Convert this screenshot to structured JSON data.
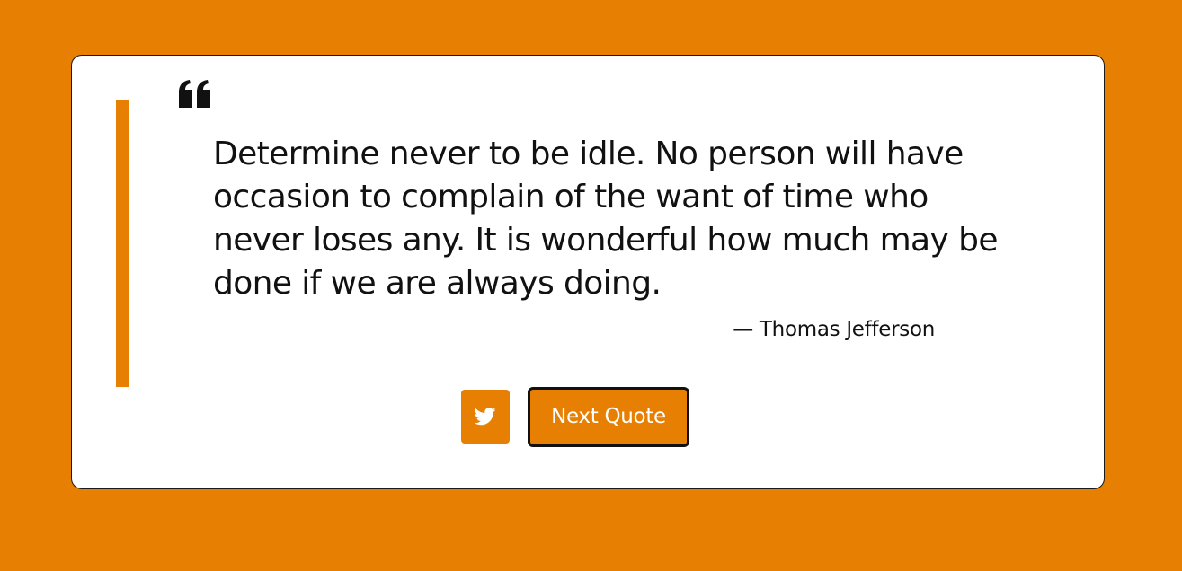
{
  "quote": {
    "text": "Determine never to be idle. No person will have occasion to complain of the want of time who never loses any. It is wonderful how much may be done if we are always doing.",
    "author": "— Thomas Jefferson"
  },
  "actions": {
    "tweet_icon": "twitter-icon",
    "next_label": "Next Quote"
  },
  "theme": {
    "accent": "#e77f02",
    "card": "#ffffff",
    "text": "#111111"
  }
}
